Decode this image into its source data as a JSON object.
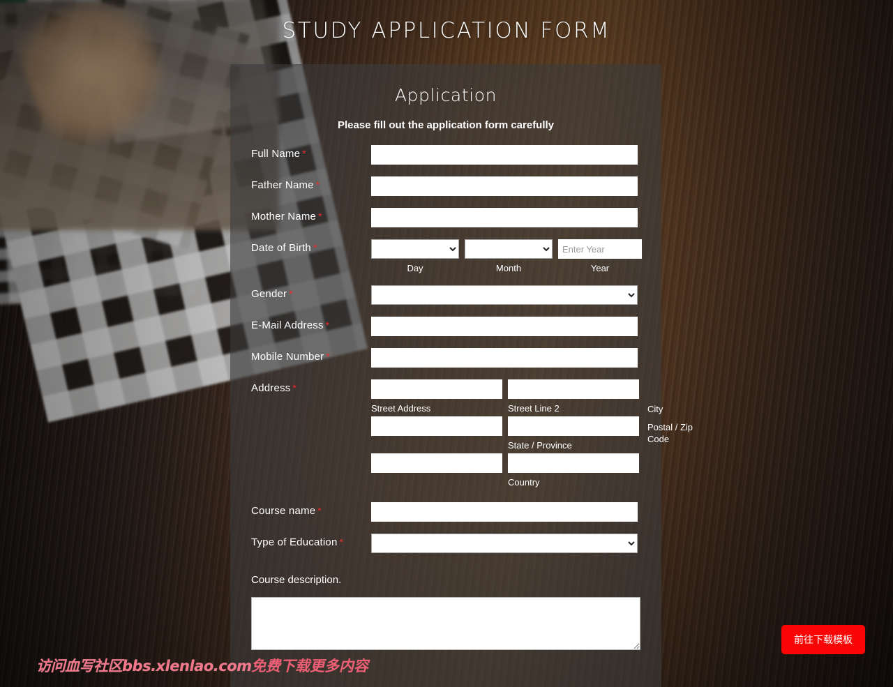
{
  "header": {
    "title": "STUDY APPLICATION FORM"
  },
  "form": {
    "heading": "Application",
    "subheading": "Please fill out the application form carefully",
    "required_marker": "*",
    "fields": {
      "full_name": {
        "label": "Full Name",
        "value": "",
        "placeholder": ""
      },
      "father_name": {
        "label": "Father Name",
        "value": "",
        "placeholder": ""
      },
      "mother_name": {
        "label": "Mother Name",
        "value": "",
        "placeholder": ""
      },
      "date_of_birth": {
        "label": "Date of Birth",
        "day": {
          "value": "",
          "sub_label": "Day"
        },
        "month": {
          "value": "",
          "sub_label": "Month"
        },
        "year": {
          "value": "",
          "placeholder": "Enter Year",
          "sub_label": "Year"
        }
      },
      "gender": {
        "label": "Gender",
        "value": ""
      },
      "email": {
        "label": "E-Mail Address",
        "value": "",
        "placeholder": ""
      },
      "mobile": {
        "label": "Mobile Number",
        "value": "",
        "placeholder": ""
      },
      "address": {
        "label": "Address",
        "street_address": {
          "value": "",
          "sub_label": "Street Address"
        },
        "street_line_2": {
          "value": "",
          "sub_label": "Street Line 2"
        },
        "city": {
          "value": "",
          "sub_label": "City"
        },
        "state_province": {
          "value": "",
          "sub_label": "State / Province"
        },
        "postal_zip": {
          "value": "",
          "sub_label": "Postal / Zip Code"
        },
        "country": {
          "value": "",
          "sub_label": "Country"
        }
      },
      "course_name": {
        "label": "Course name",
        "value": "",
        "placeholder": ""
      },
      "type_of_education": {
        "label": "Type of Education",
        "value": ""
      },
      "course_description": {
        "label": "Course description.",
        "value": "",
        "placeholder": ""
      }
    }
  },
  "overlay": {
    "watermark_left": "访问血写社区bbs.xlenlao.com",
    "watermark_right": "免费下载更多内容",
    "download_button": "前往下载模板",
    "accent_red": "#fa0505",
    "watermark_pink": "#ef5f76",
    "required_red": "#f02b2b"
  }
}
